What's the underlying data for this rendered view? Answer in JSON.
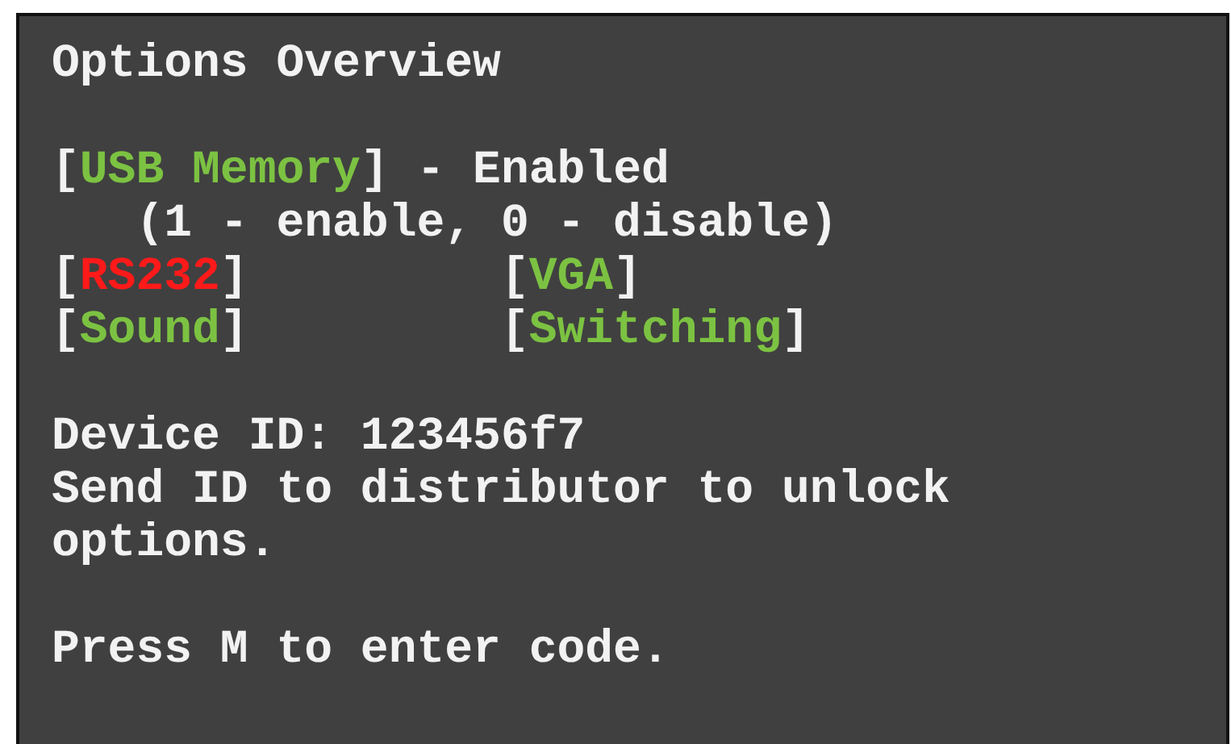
{
  "title": "Options Overview",
  "featured_option": {
    "open": "[",
    "name": "USB Memory",
    "close": "]",
    "enabled": true,
    "status": "- Enabled",
    "hint": "(1 - enable, 0 - disable)"
  },
  "options": [
    {
      "open": "[",
      "name": "RS232",
      "close": "]",
      "enabled": false
    },
    {
      "open": "[",
      "name": "VGA",
      "close": "]",
      "enabled": true
    },
    {
      "open": "[",
      "name": "Sound",
      "close": "]",
      "enabled": true
    },
    {
      "open": "[",
      "name": "Switching",
      "close": "]",
      "enabled": true
    }
  ],
  "device_id": "Device ID: 123456f7",
  "unlock_message": "Send ID to distributor to unlock options.",
  "prompt": "Press M to enter code."
}
